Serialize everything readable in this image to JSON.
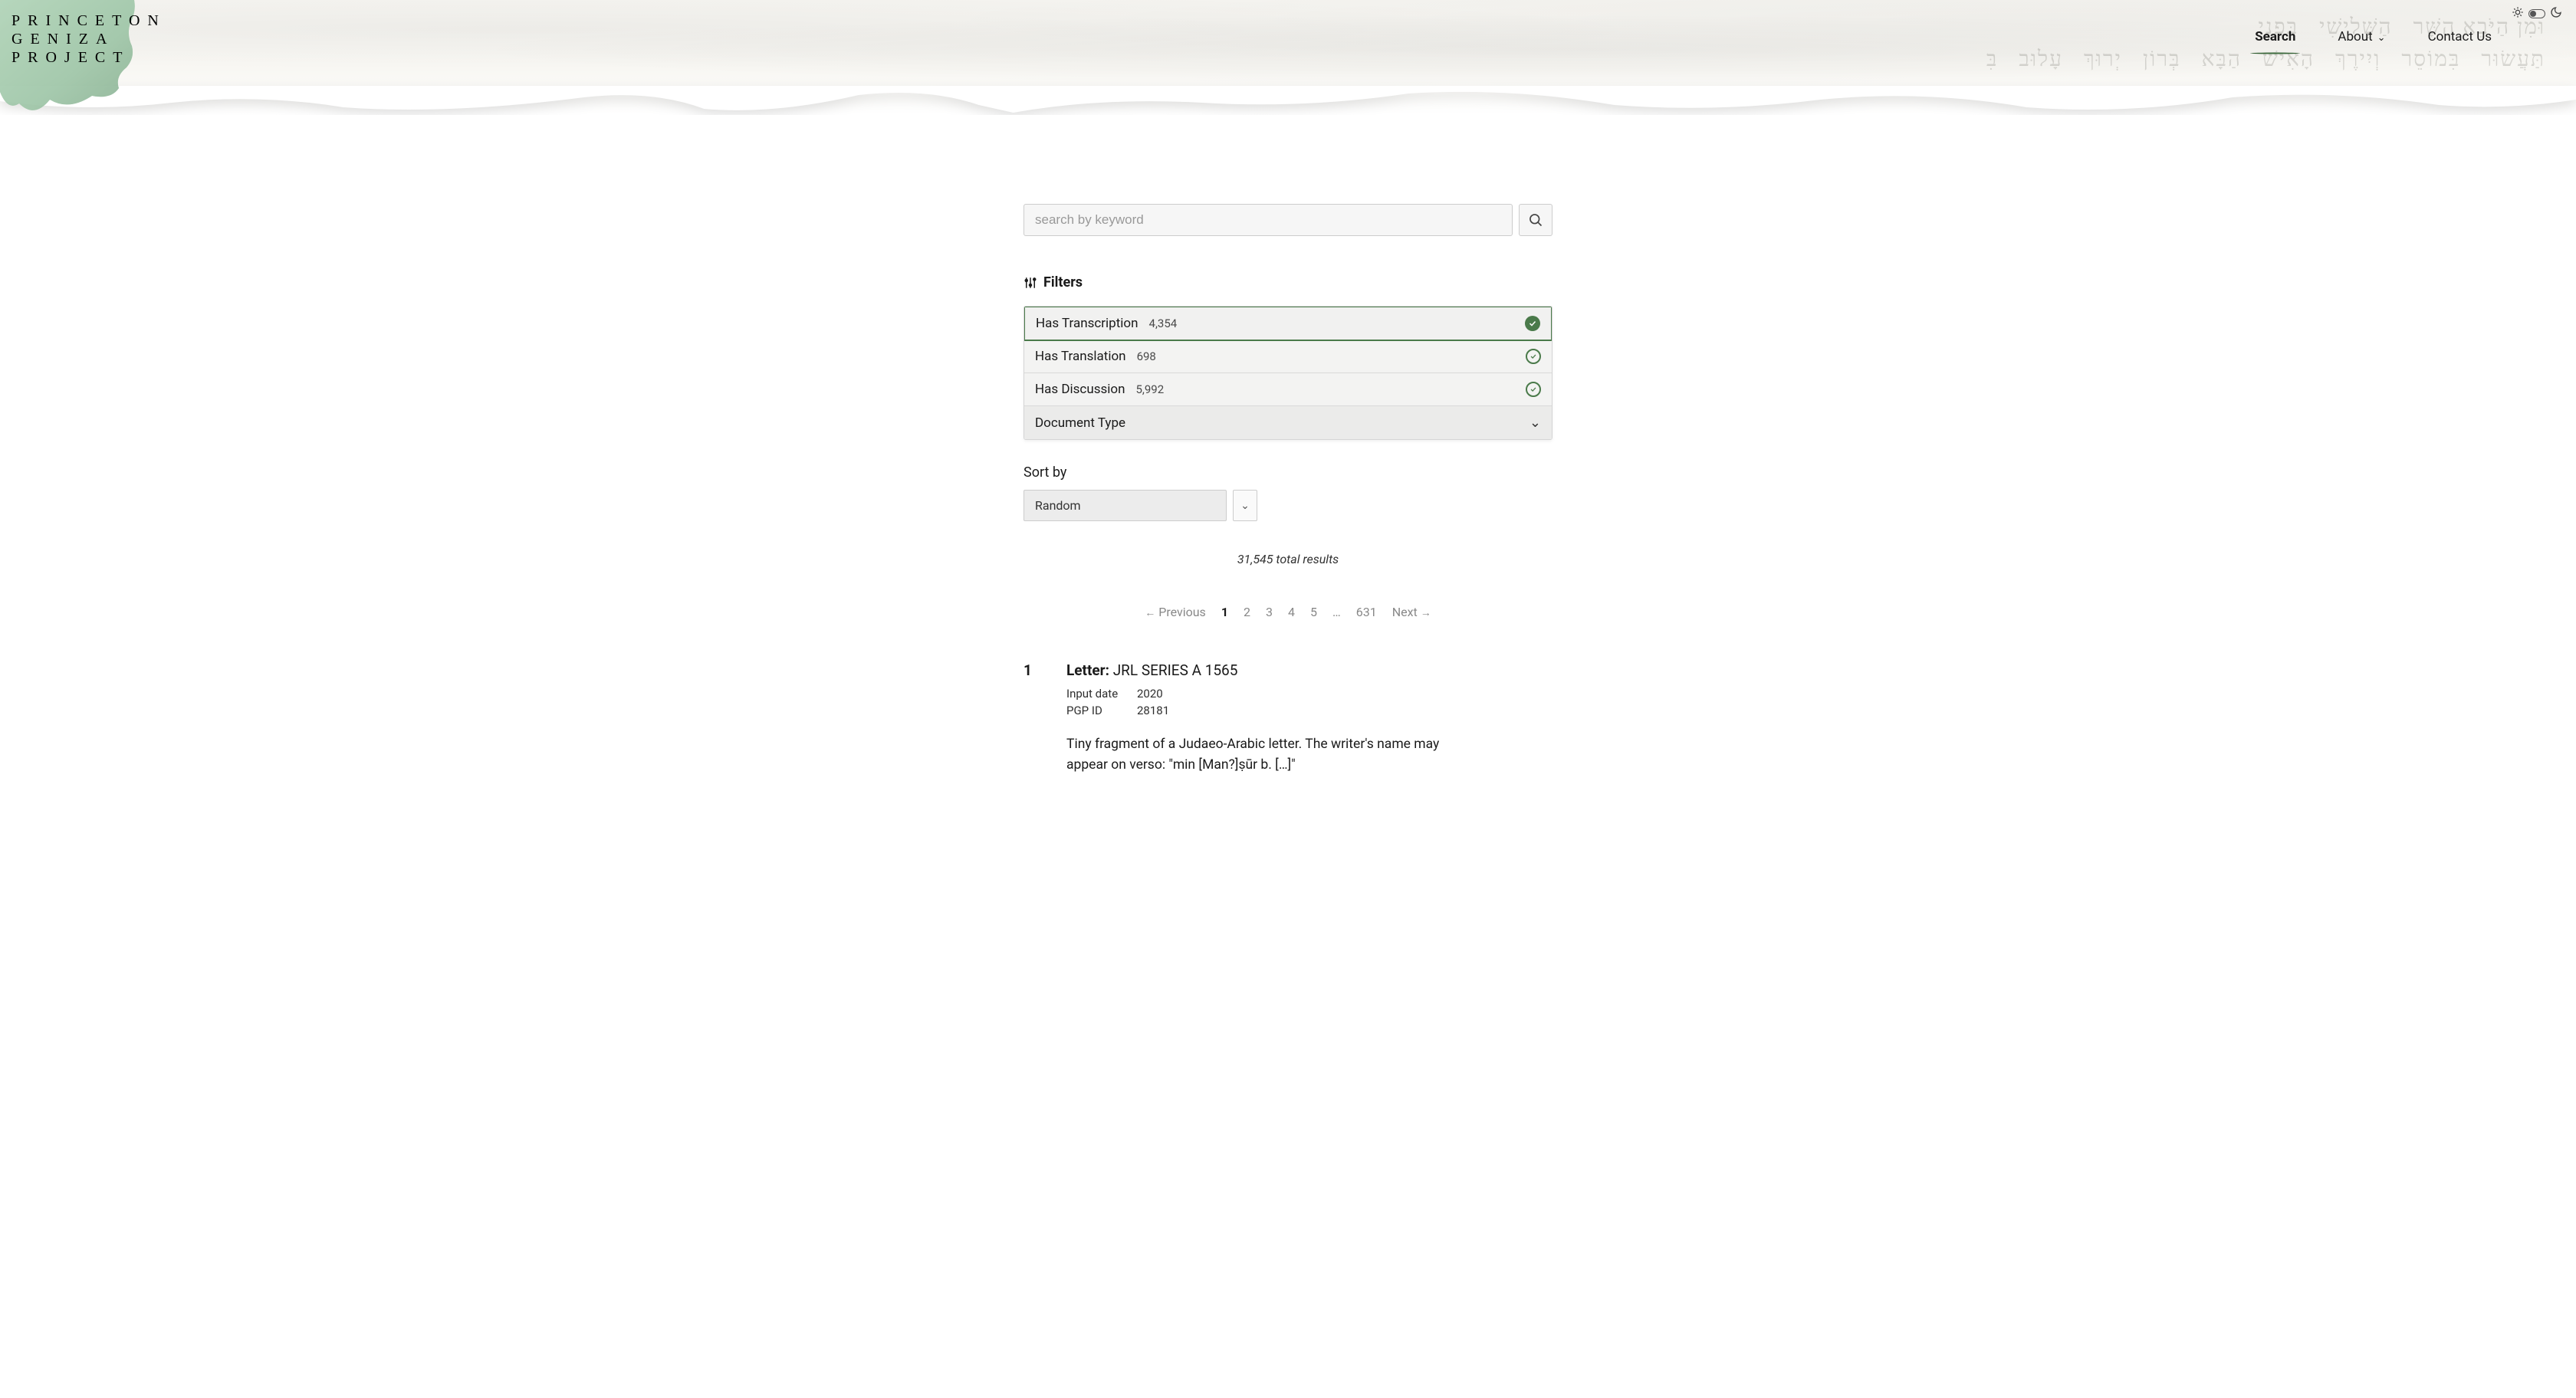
{
  "site": {
    "name_line1": "PRINCETON",
    "name_line2": "GENIZA",
    "name_line3": "PROJECT"
  },
  "nav": {
    "search": "Search",
    "about": "About",
    "contact": "Contact Us"
  },
  "search": {
    "placeholder": "search by keyword",
    "value": ""
  },
  "filters": {
    "heading": "Filters",
    "items": [
      {
        "label": "Has Transcription",
        "count": "4,354",
        "selected": true
      },
      {
        "label": "Has Translation",
        "count": "698",
        "selected": false
      },
      {
        "label": "Has Discussion",
        "count": "5,992",
        "selected": false
      }
    ],
    "doctype_label": "Document Type"
  },
  "sort": {
    "label": "Sort by",
    "selected": "Random"
  },
  "results": {
    "total_text": "31,545 total results"
  },
  "pagination": {
    "prev": "Previous",
    "pages": [
      "1",
      "2",
      "3",
      "4",
      "5"
    ],
    "ellipsis": "…",
    "last": "631",
    "next": "Next",
    "current": "1"
  },
  "result1": {
    "index": "1",
    "type_label": "Letter:",
    "shelfmark": "JRL SERIES A 1565",
    "meta": [
      {
        "k": "Input date",
        "v": "2020"
      },
      {
        "k": "PGP ID",
        "v": "28181"
      }
    ],
    "description": "Tiny fragment of a Judaeo-Arabic letter. The writer's name may appear on verso: \"min [Man?]ṣūr b. […]\""
  }
}
